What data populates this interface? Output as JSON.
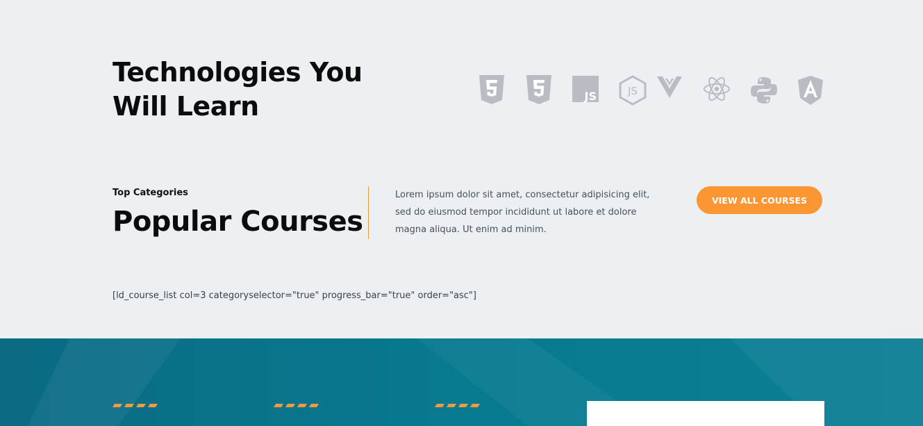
{
  "tech": {
    "title_line1": "Technologies You",
    "title_line2": "Will Learn",
    "icons": [
      "html5-icon",
      "css3-icon",
      "javascript-icon",
      "nodejs-icon",
      "vuejs-icon",
      "react-icon",
      "python-icon",
      "angular-icon"
    ],
    "icon_labels": {
      "javascript": "JS",
      "nodejs": "JS"
    }
  },
  "courses": {
    "eyebrow": "Top Categories",
    "title": "Popular Courses",
    "description": "Lorem ipsum dolor sit amet, consectetur adipisicing elit, sed do eiusmod tempor incididunt ut labore et dolore magna aliqua. Ut enim ad minim.",
    "button_label": "VIEW ALL COURSES",
    "shortcode": "[ld_course_list col=3 categoryselector=\"true\" progress_bar=\"true\" order=\"asc\"]"
  },
  "colors": {
    "background": "#edf0f3",
    "accent": "#fc9633",
    "band": "#087a90",
    "icon": "#b6bac0"
  }
}
